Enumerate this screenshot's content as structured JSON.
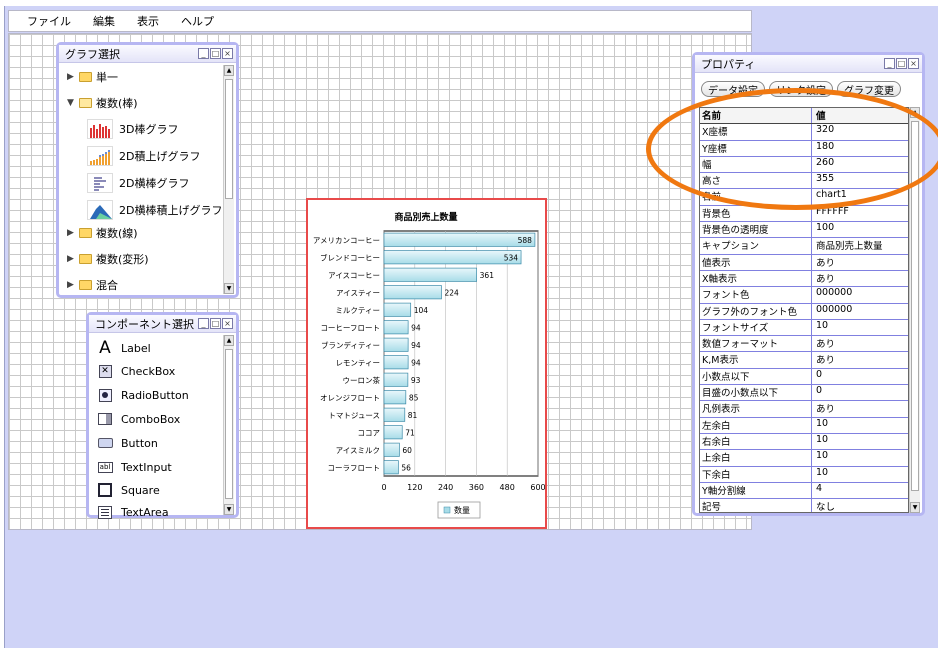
{
  "menu": [
    "ファイル",
    "編集",
    "表示",
    "ヘルプ"
  ],
  "graph_panel": {
    "title": "グラフ選択",
    "nodes": [
      {
        "label": "単一",
        "expanded": false
      },
      {
        "label": "複数(棒)",
        "expanded": true
      },
      {
        "label": "複数(線)",
        "expanded": false
      },
      {
        "label": "複数(変形)",
        "expanded": false
      },
      {
        "label": "混合",
        "expanded": false
      }
    ],
    "leaves": [
      "3D棒グラフ",
      "2D積上げグラフ",
      "2D横棒グラフ",
      "2D横棒積上げグラフ"
    ]
  },
  "comp_panel": {
    "title": "コンポーネント選択",
    "items": [
      {
        "icon": "label-icon",
        "label": "Label"
      },
      {
        "icon": "checkbox-icon",
        "label": "CheckBox"
      },
      {
        "icon": "radiobutton-icon",
        "label": "RadioButton"
      },
      {
        "icon": "combobox-icon",
        "label": "ComboBox"
      },
      {
        "icon": "button-icon",
        "label": "Button"
      },
      {
        "icon": "textinput-icon",
        "label": "TextInput"
      },
      {
        "icon": "square-icon",
        "label": "Square"
      },
      {
        "icon": "textarea-icon",
        "label": "TextArea"
      }
    ]
  },
  "chart_data": {
    "type": "bar",
    "orientation": "horizontal",
    "title": "商品別売上数量",
    "categories": [
      "アメリカンコーヒー",
      "ブレンドコーヒー",
      "アイスコーヒー",
      "アイスティー",
      "ミルクティー",
      "コーヒーフロート",
      "ブランディティー",
      "レモンティー",
      "ウーロン茶",
      "オレンジフロート",
      "トマトジュース",
      "ココア",
      "アイスミルク",
      "コーラフロート"
    ],
    "series": [
      {
        "name": "数量",
        "values": [
          588,
          534,
          361,
          224,
          104,
          94,
          94,
          94,
          93,
          85,
          81,
          71,
          60,
          56
        ]
      }
    ],
    "xlim": [
      0,
      600
    ],
    "xticks": [
      "0",
      "120",
      "240",
      "360",
      "480",
      "600"
    ],
    "legend": "bottom",
    "grid": true,
    "color": "#a8dce8"
  },
  "prop_panel": {
    "title": "プロパティ",
    "buttons": [
      "データ設定",
      "リンク設定",
      "グラフ変更"
    ],
    "header": {
      "name": "名前",
      "value": "値"
    },
    "rows": [
      {
        "name": "X座標",
        "value": "320"
      },
      {
        "name": "Y座標",
        "value": "180"
      },
      {
        "name": "幅",
        "value": "260"
      },
      {
        "name": "高さ",
        "value": "355"
      },
      {
        "name": "名前",
        "value": "chart1"
      },
      {
        "name": "背景色",
        "value": "FFFFFF"
      },
      {
        "name": "背景色の透明度",
        "value": "100"
      },
      {
        "name": "キャプション",
        "value": "商品別売上数量"
      },
      {
        "name": "値表示",
        "value": "あり"
      },
      {
        "name": "X軸表示",
        "value": "あり"
      },
      {
        "name": "フォント色",
        "value": "000000"
      },
      {
        "name": "グラフ外のフォント色",
        "value": "000000"
      },
      {
        "name": "フォントサイズ",
        "value": "10"
      },
      {
        "name": "数値フォーマット",
        "value": "あり"
      },
      {
        "name": "K,M表示",
        "value": "あり"
      },
      {
        "name": "小数点以下",
        "value": "0"
      },
      {
        "name": "目盛の小数点以下",
        "value": "0"
      },
      {
        "name": "凡例表示",
        "value": "あり"
      },
      {
        "name": "左余白",
        "value": "10"
      },
      {
        "name": "右余白",
        "value": "10"
      },
      {
        "name": "上余白",
        "value": "10"
      },
      {
        "name": "下余白",
        "value": "10"
      },
      {
        "name": "Y軸分割線",
        "value": "4"
      },
      {
        "name": "記号",
        "value": "なし"
      }
    ]
  }
}
